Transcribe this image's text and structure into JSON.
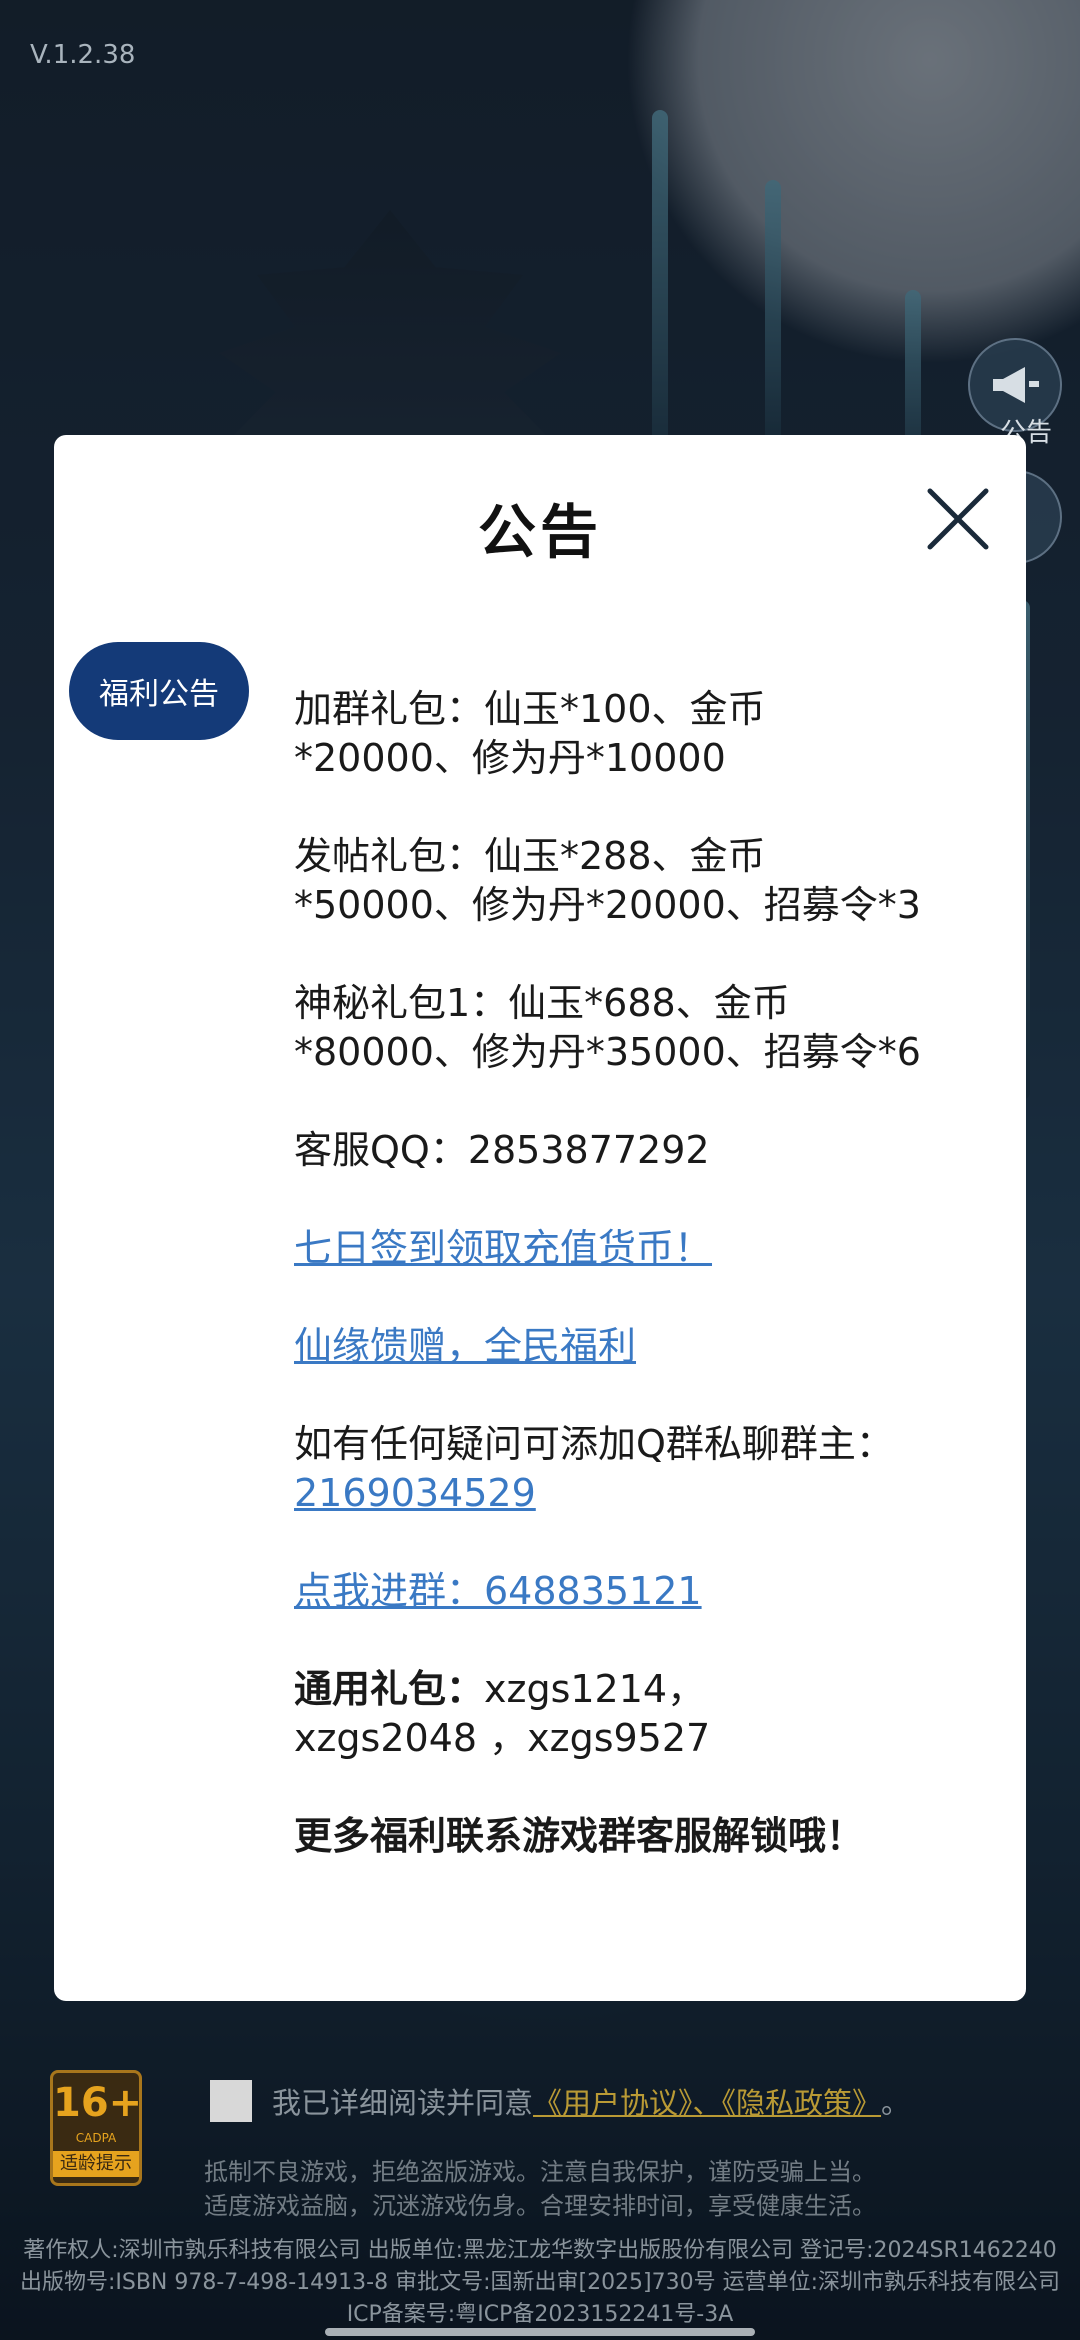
{
  "app": {
    "version": "V.1.2.38",
    "side_buttons": [
      "公告"
    ]
  },
  "modal": {
    "title": "公告",
    "tab_label": "福利公告",
    "lines": {
      "p1a": "加群礼包：仙玉*100、金币",
      "p1b": "*20000、修为丹*10000",
      "p2a": "发帖礼包：仙玉*288、金币",
      "p2b": "*50000、修为丹*20000、招募令*3",
      "p3a": "神秘礼包1：仙玉*688、金币",
      "p3b": "*80000、修为丹*35000、招募令*6",
      "qq": "客服QQ：2853877292",
      "link_sign": "七日签到领取充值货币！",
      "link_gift": "仙缘馈赠，全民福利",
      "question": "如有任何疑问可添加Q群私聊群主：",
      "question_link": "2169034529",
      "link_group": "点我进群：648835121",
      "code_label": "通用礼包：",
      "code_a": "xzgs1214，",
      "code_b": "xzgs2048 ，xzgs9527",
      "more": "更多福利联系游戏群客服解锁哦！"
    }
  },
  "footer": {
    "age_rating": "16+",
    "age_org": "CADPA",
    "age_tip": "适龄提示",
    "agree_text": "我已详细阅读并同意",
    "agree_links": "《用户协议》、《隐私政策》",
    "agree_end": "。",
    "notice1": "抵制不良游戏，拒绝盗版游戏。注意自我保护，谨防受骗上当。",
    "notice2": "适度游戏益脑，沉迷游戏伤身。合理安排时间，享受健康生活。",
    "copy1": "著作权人:深圳市孰乐科技有限公司 出版单位:黑龙江龙华数字出版股份有限公司 登记号:2024SR1462240",
    "copy2": "出版物号:ISBN 978-7-498-14913-8 审批文号:国新出审[2025]730号 运营单位:深圳市孰乐科技有限公司",
    "copy3": "ICP备案号:粤ICP备2023152241号-3A"
  },
  "colors": {
    "tab_bg": "#143a78",
    "link": "#3a79c4",
    "agree_link": "#b99a35"
  }
}
